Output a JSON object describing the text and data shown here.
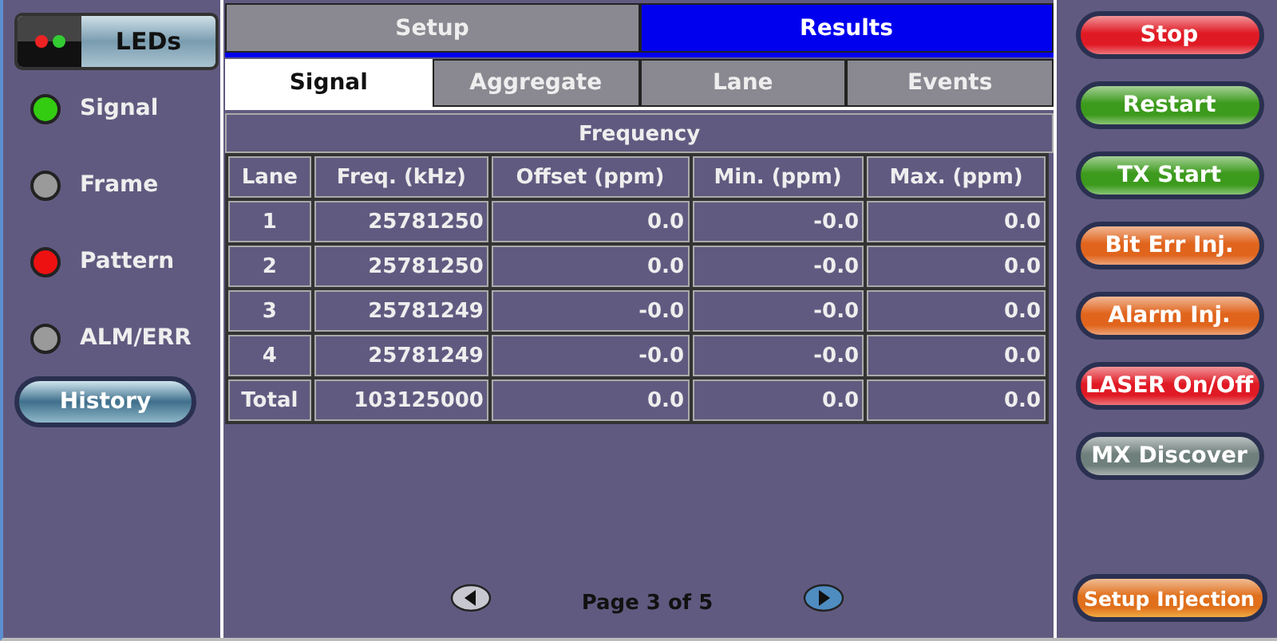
{
  "leds_button": {
    "label": "LEDs"
  },
  "leds": [
    {
      "label": "Signal",
      "color": "#33cc11"
    },
    {
      "label": "Frame",
      "color": "#9a9a9a"
    },
    {
      "label": "Pattern",
      "color": "#ee1111"
    },
    {
      "label": "ALM/ERR",
      "color": "#9a9a9a"
    }
  ],
  "history_button": {
    "label": "History"
  },
  "tabs": [
    {
      "label": "Setup",
      "selected": false
    },
    {
      "label": "Results",
      "selected": true
    }
  ],
  "subtabs": [
    {
      "label": "Signal",
      "selected": true
    },
    {
      "label": "Aggregate",
      "selected": false
    },
    {
      "label": "Lane",
      "selected": false
    },
    {
      "label": "Events",
      "selected": false
    }
  ],
  "table": {
    "title": "Frequency",
    "columns": [
      "Lane",
      "Freq. (kHz)",
      "Offset (ppm)",
      "Min. (ppm)",
      "Max. (ppm)"
    ],
    "rows": [
      [
        "1",
        "25781250",
        "0.0",
        "-0.0",
        "0.0"
      ],
      [
        "2",
        "25781250",
        "0.0",
        "-0.0",
        "0.0"
      ],
      [
        "3",
        "25781249",
        "-0.0",
        "-0.0",
        "0.0"
      ],
      [
        "4",
        "25781249",
        "-0.0",
        "-0.0",
        "0.0"
      ],
      [
        "Total",
        "103125000",
        "0.0",
        "0.0",
        "0.0"
      ]
    ]
  },
  "pager": {
    "label": "Page 3 of 5"
  },
  "actions": [
    {
      "label": "Stop",
      "color": "#e01a24"
    },
    {
      "label": "Restart",
      "color": "#3c9a1c"
    },
    {
      "label": "TX Start",
      "color": "#3c9a1c"
    },
    {
      "label": "Bit Err Inj.",
      "color": "#e0641c"
    },
    {
      "label": "Alarm Inj.",
      "color": "#e0641c"
    },
    {
      "label": "LASER On/Off",
      "color": "#e01a24"
    },
    {
      "label": "MX Discover",
      "color": "#6f7f7c"
    }
  ],
  "footer_action": {
    "label": "Setup Injection",
    "color": "#e0701c"
  }
}
